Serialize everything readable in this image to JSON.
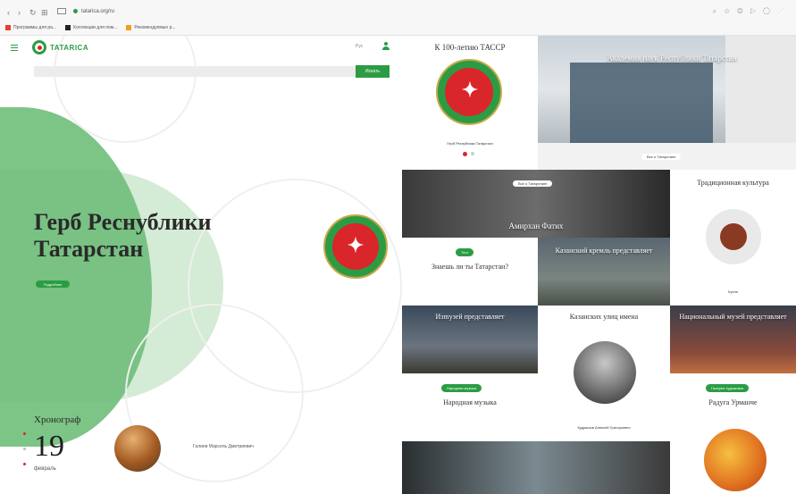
{
  "browser": {
    "url": "tatarica.org/ru",
    "bookmarks": [
      "Программы для ра...",
      "Коллекции для пом...",
      "Рекомендуемые р..."
    ],
    "ext_icons": "⌕ ☆ ◎ ▷ ◯ ⋰"
  },
  "header": {
    "logo_text": "TATARICA",
    "lang": "Рус",
    "search_placeholder": "",
    "search_button": "Искать"
  },
  "hero": {
    "title": "Герб Реснублики Татарстан",
    "button": "Подробнее"
  },
  "chronograph": {
    "title": "Хронограф",
    "day": "19",
    "month": "февраль",
    "person": "Галиев Марсель Дмитриевич"
  },
  "tiles": {
    "tassr": {
      "title": "К 100-летию ТАССР",
      "caption": "Герб Республики Татарстан"
    },
    "academy": {
      "title": "Академия наук Республики Татарстан",
      "pill": "Все о Татарстане"
    },
    "fatih": {
      "title": "Амирхан Фатих",
      "pill": "Все о Татарстане"
    },
    "culture": {
      "title": "Традиционная культура",
      "caption": "Кухня"
    },
    "quiz": {
      "pill": "Тест",
      "title": "Знаешь ли ты Татарстан?"
    },
    "kremlin": {
      "title": "Казанский кремль представляет"
    },
    "izmuzey": {
      "title": "Изmузей представляет"
    },
    "streets": {
      "title": "Казанских улиц имена",
      "caption": "Кудряшов Алексей Григорьевич"
    },
    "national": {
      "title": "Национальный музей представляет"
    },
    "music": {
      "pill": "Народная музыка",
      "title": "Народная музыка"
    },
    "urmanche": {
      "pill": "Галерея художника",
      "title": "Радуга Урманче"
    }
  },
  "colors": {
    "brand_green": "#2c9c44",
    "accent_red": "#d9262b"
  }
}
